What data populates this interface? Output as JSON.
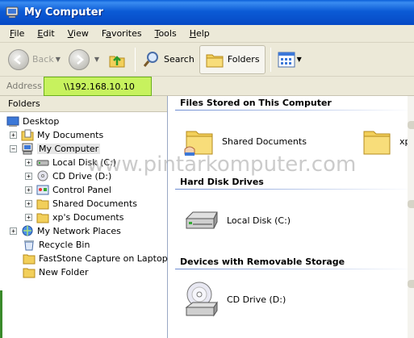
{
  "window": {
    "title": "My Computer"
  },
  "menu": [
    "File",
    "Edit",
    "View",
    "Favorites",
    "Tools",
    "Help"
  ],
  "menu_underline": [
    "F",
    "E",
    "V",
    "a",
    "T",
    "H"
  ],
  "toolbar": {
    "back_label": "Back",
    "search_label": "Search",
    "folders_label": "Folders"
  },
  "address": {
    "label": "Address",
    "value": "\\\\192.168.10.10"
  },
  "folders_pane": {
    "header": "Folders",
    "tree": [
      {
        "label": "Desktop"
      },
      {
        "label": "My Documents"
      },
      {
        "label": "My Computer"
      },
      {
        "label": "Local Disk (C:)"
      },
      {
        "label": "CD Drive (D:)"
      },
      {
        "label": "Control Panel"
      },
      {
        "label": "Shared Documents"
      },
      {
        "label": "xp's Documents"
      },
      {
        "label": "My Network Places"
      },
      {
        "label": "Recycle Bin"
      },
      {
        "label": "FastStone Capture on Laptop Pri"
      },
      {
        "label": "New Folder"
      }
    ]
  },
  "content": {
    "groups": [
      {
        "title": "Files Stored on This Computer",
        "items": [
          "Shared Documents",
          "xp's"
        ]
      },
      {
        "title": "Hard Disk Drives",
        "items": [
          "Local Disk (C:)"
        ]
      },
      {
        "title": "Devices with Removable Storage",
        "items": [
          "CD Drive (D:)"
        ]
      }
    ]
  },
  "watermark": "www.pintarkomputer.com"
}
